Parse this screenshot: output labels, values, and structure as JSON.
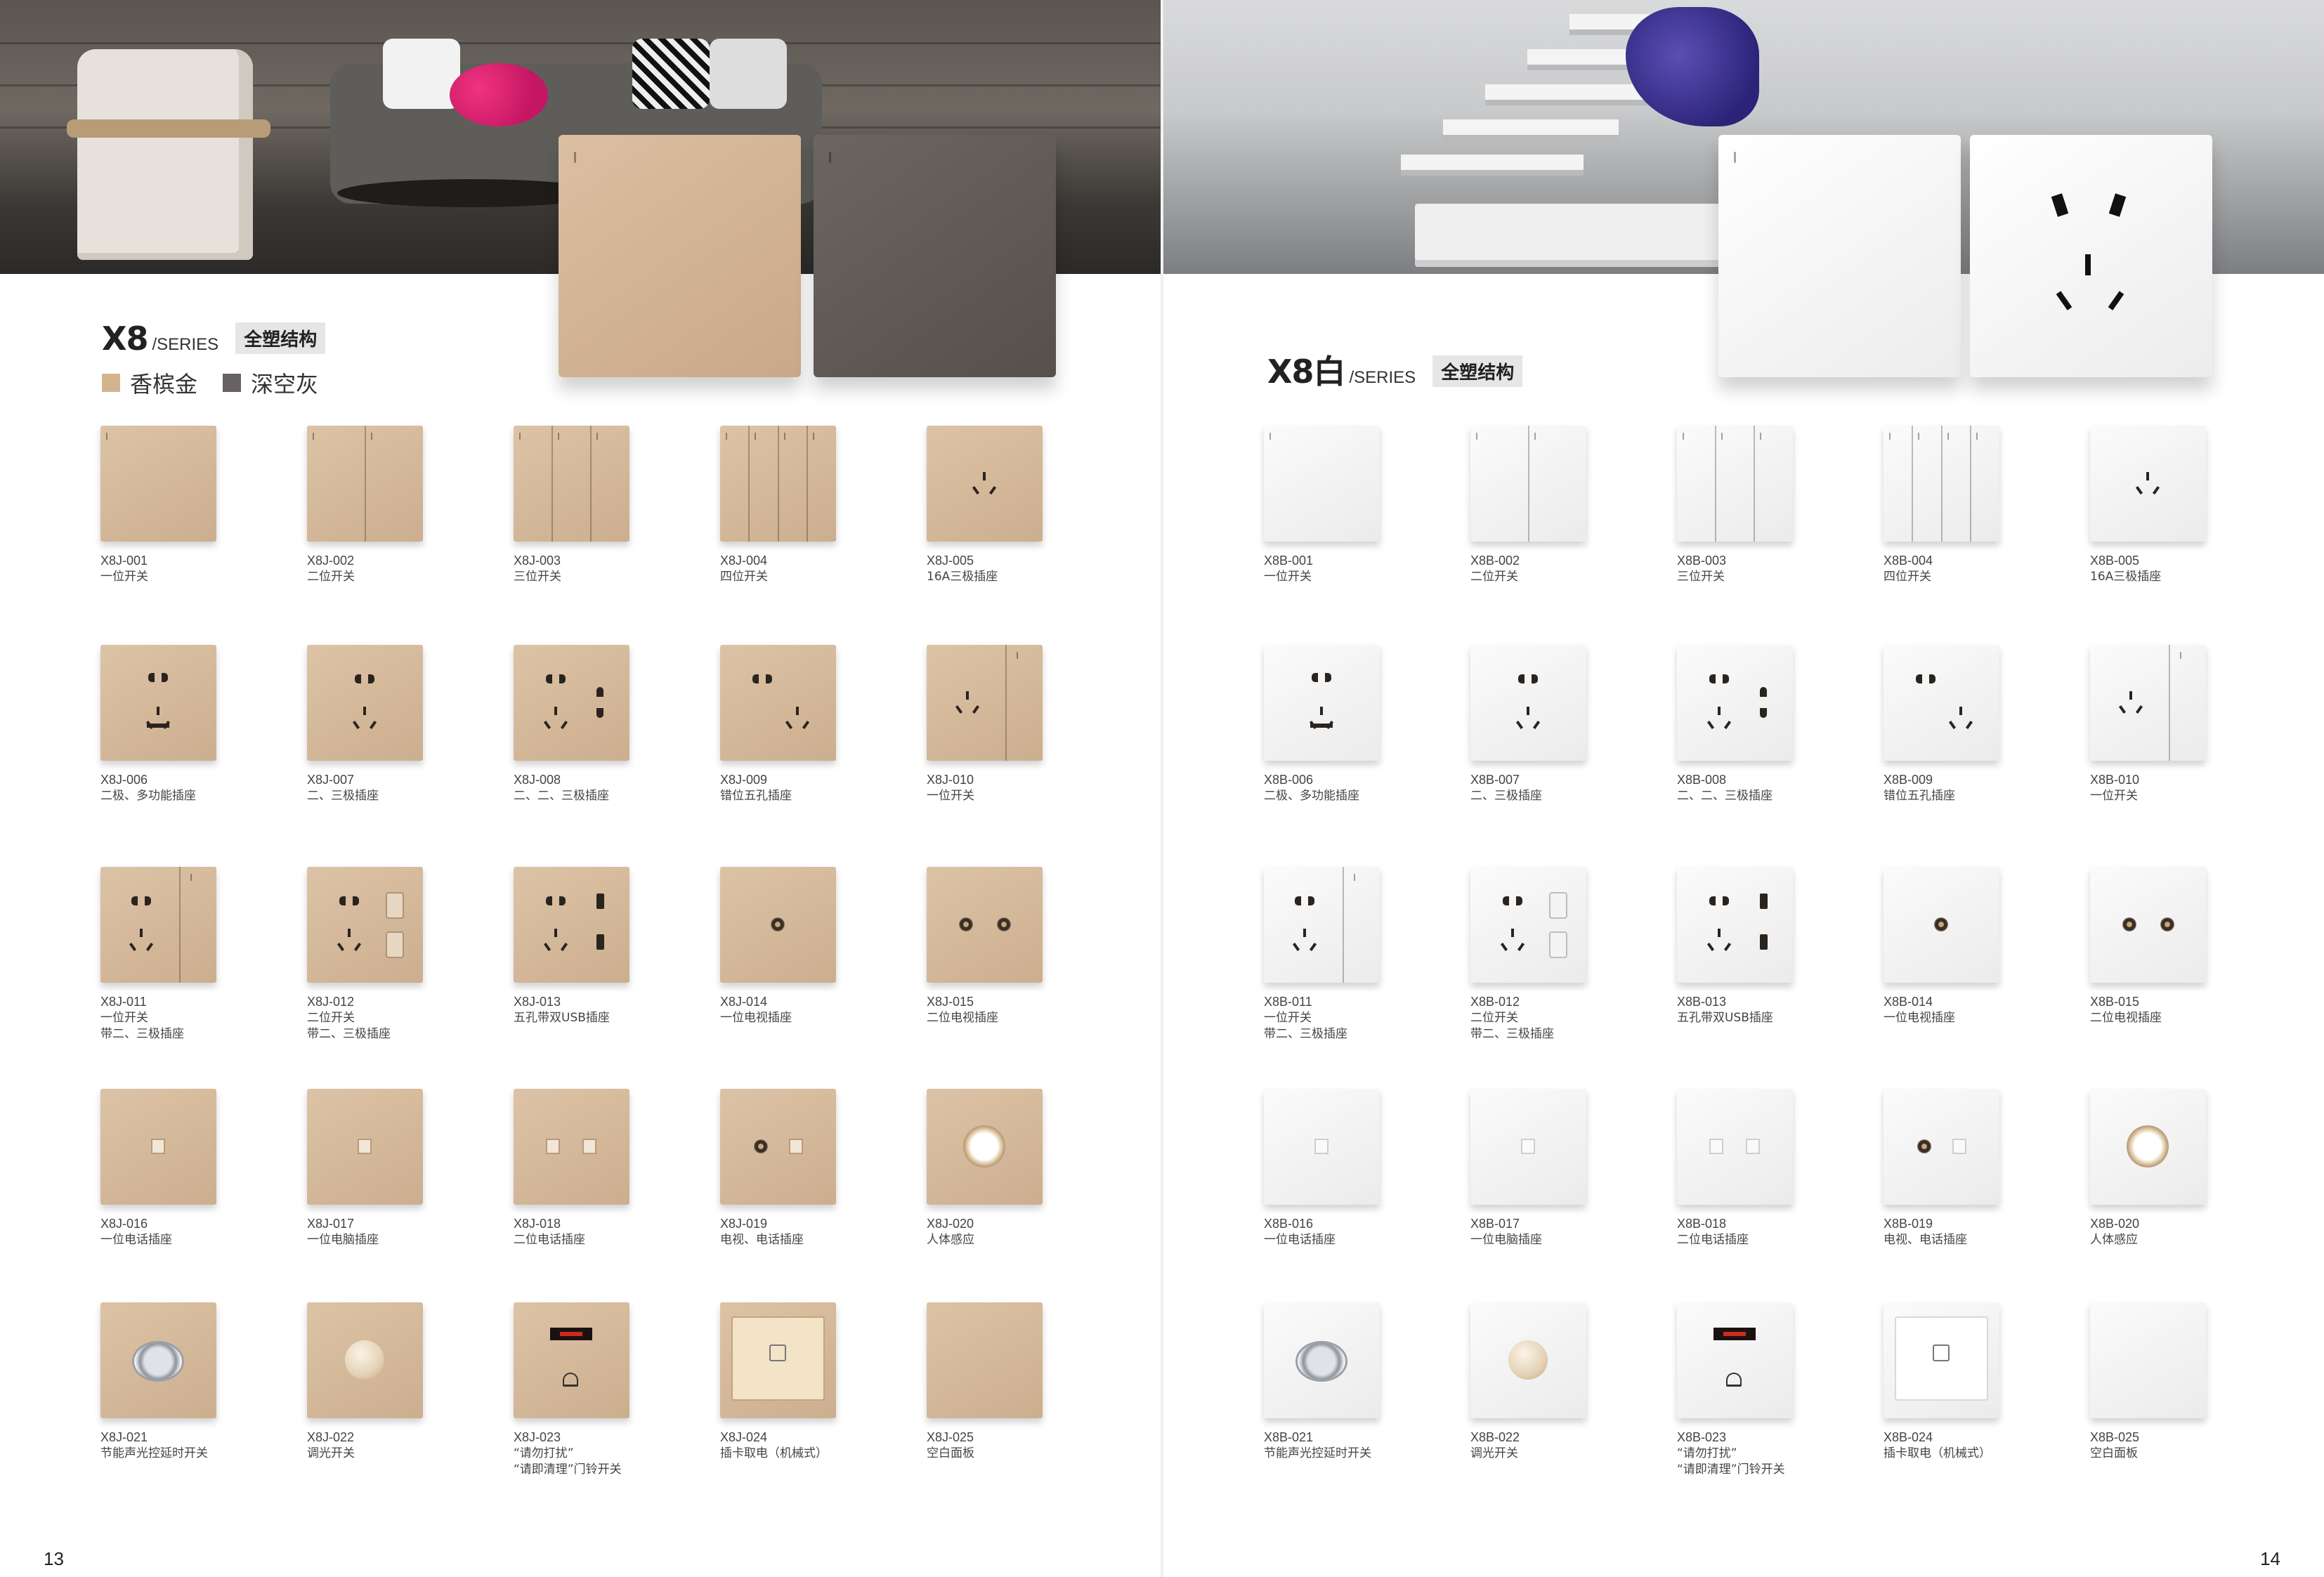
{
  "left_page": {
    "series": "X8",
    "series_suffix": "/SERIES",
    "tag": "全塑结构",
    "colors": [
      {
        "name": "香槟金",
        "hex": "#d3b48f"
      },
      {
        "name": "深空灰",
        "hex": "#666261"
      }
    ],
    "page_number": "13",
    "items": [
      {
        "code": "X8J-001",
        "desc": "一位开关",
        "type": "gang1"
      },
      {
        "code": "X8J-002",
        "desc": "二位开关",
        "type": "gang2"
      },
      {
        "code": "X8J-003",
        "desc": "三位开关",
        "type": "gang3"
      },
      {
        "code": "X8J-004",
        "desc": "四位开关",
        "type": "gang4"
      },
      {
        "code": "X8J-005",
        "desc": "16A三极插座",
        "type": "socket3"
      },
      {
        "code": "X8J-006",
        "desc": "二极、多功能插座",
        "type": "multi"
      },
      {
        "code": "X8J-007",
        "desc": "二、三极插座",
        "type": "socket5"
      },
      {
        "code": "X8J-008",
        "desc": "二、二、三极插座",
        "type": "socket223"
      },
      {
        "code": "X8J-009",
        "desc": "错位五孔插座",
        "type": "offset5"
      },
      {
        "code": "X8J-010",
        "desc": "一位开关",
        "type": "switch_socket3"
      },
      {
        "code": "X8J-011",
        "desc": "一位开关\n带二、三极插座",
        "type": "switch_socket5"
      },
      {
        "code": "X8J-012",
        "desc": "二位开关\n带二、三极插座",
        "type": "socket5_rockers"
      },
      {
        "code": "X8J-013",
        "desc": "五孔带双USB插座",
        "type": "socket5_usb"
      },
      {
        "code": "X8J-014",
        "desc": "一位电视插座",
        "type": "tv1"
      },
      {
        "code": "X8J-015",
        "desc": "二位电视插座",
        "type": "tv2"
      },
      {
        "code": "X8J-016",
        "desc": "一位电话插座",
        "type": "rj1"
      },
      {
        "code": "X8J-017",
        "desc": "一位电脑插座",
        "type": "rj1"
      },
      {
        "code": "X8J-018",
        "desc": "二位电话插座",
        "type": "rj2"
      },
      {
        "code": "X8J-019",
        "desc": "电视、电话插座",
        "type": "tv_rj"
      },
      {
        "code": "X8J-020",
        "desc": "人体感应",
        "type": "sensor"
      },
      {
        "code": "X8J-021",
        "desc": "节能声光控延时开关",
        "type": "sound"
      },
      {
        "code": "X8J-022",
        "desc": "调光开关",
        "type": "dimmer"
      },
      {
        "code": "X8J-023",
        "desc": "“请勿打扰”\n“请即清理”门铃开关",
        "type": "dnd"
      },
      {
        "code": "X8J-024",
        "desc": "插卡取电（机械式）",
        "type": "card"
      },
      {
        "code": "X8J-025",
        "desc": "空白面板",
        "type": "blank"
      }
    ]
  },
  "right_page": {
    "series": "X8白",
    "series_suffix": "/SERIES",
    "tag": "全塑结构",
    "page_number": "14",
    "items": [
      {
        "code": "X8B-001",
        "desc": "一位开关",
        "type": "gang1"
      },
      {
        "code": "X8B-002",
        "desc": "二位开关",
        "type": "gang2"
      },
      {
        "code": "X8B-003",
        "desc": "三位开关",
        "type": "gang3"
      },
      {
        "code": "X8B-004",
        "desc": "四位开关",
        "type": "gang4"
      },
      {
        "code": "X8B-005",
        "desc": "16A三极插座",
        "type": "socket3"
      },
      {
        "code": "X8B-006",
        "desc": "二极、多功能插座",
        "type": "multi"
      },
      {
        "code": "X8B-007",
        "desc": "二、三极插座",
        "type": "socket5"
      },
      {
        "code": "X8B-008",
        "desc": "二、二、三极插座",
        "type": "socket223"
      },
      {
        "code": "X8B-009",
        "desc": "错位五孔插座",
        "type": "offset5"
      },
      {
        "code": "X8B-010",
        "desc": "一位开关",
        "type": "switch_socket3"
      },
      {
        "code": "X8B-011",
        "desc": "一位开关\n带二、三极插座",
        "type": "switch_socket5"
      },
      {
        "code": "X8B-012",
        "desc": "二位开关\n带二、三极插座",
        "type": "socket5_rockers"
      },
      {
        "code": "X8B-013",
        "desc": "五孔带双USB插座",
        "type": "socket5_usb"
      },
      {
        "code": "X8B-014",
        "desc": "一位电视插座",
        "type": "tv1"
      },
      {
        "code": "X8B-015",
        "desc": "二位电视插座",
        "type": "tv2"
      },
      {
        "code": "X8B-016",
        "desc": "一位电话插座",
        "type": "rj1"
      },
      {
        "code": "X8B-017",
        "desc": "一位电脑插座",
        "type": "rj1"
      },
      {
        "code": "X8B-018",
        "desc": "二位电话插座",
        "type": "rj2"
      },
      {
        "code": "X8B-019",
        "desc": "电视、电话插座",
        "type": "tv_rj"
      },
      {
        "code": "X8B-020",
        "desc": "人体感应",
        "type": "sensor"
      },
      {
        "code": "X8B-021",
        "desc": "节能声光控延时开关",
        "type": "sound"
      },
      {
        "code": "X8B-022",
        "desc": "调光开关",
        "type": "dimmer"
      },
      {
        "code": "X8B-023",
        "desc": "“请勿打扰”\n“请即清理”门铃开关",
        "type": "dnd"
      },
      {
        "code": "X8B-024",
        "desc": "插卡取电（机械式）",
        "type": "card"
      },
      {
        "code": "X8B-025",
        "desc": "空白面板",
        "type": "blank"
      }
    ]
  }
}
